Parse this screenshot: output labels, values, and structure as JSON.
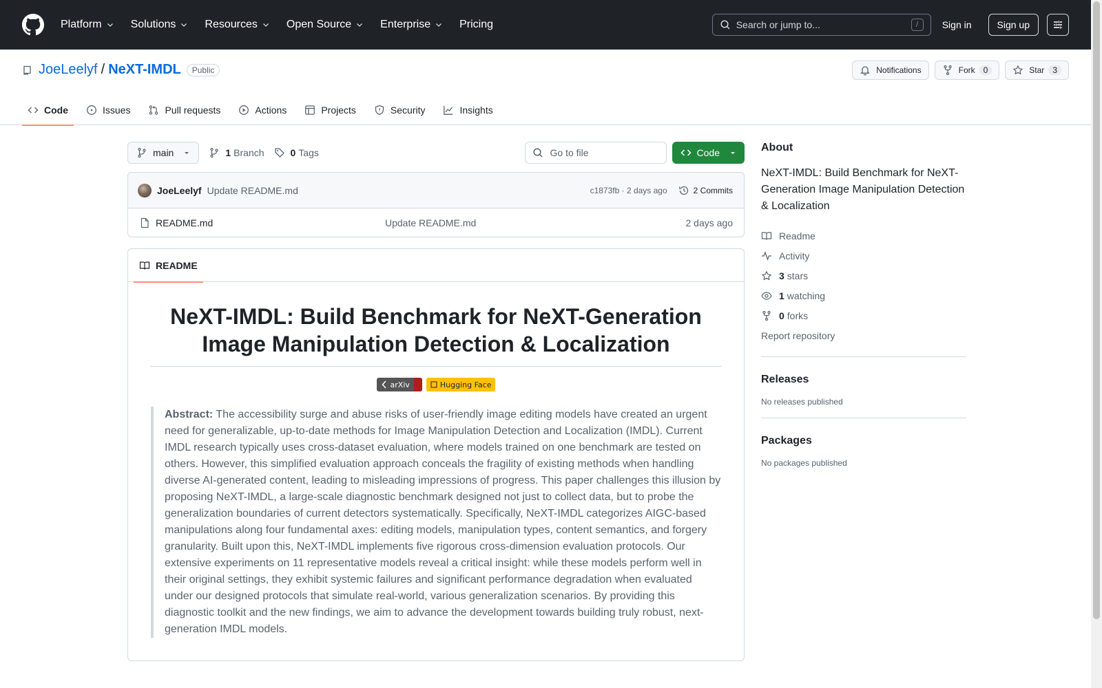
{
  "header": {
    "nav": [
      {
        "label": "Platform",
        "has_menu": true
      },
      {
        "label": "Solutions",
        "has_menu": true
      },
      {
        "label": "Resources",
        "has_menu": true
      },
      {
        "label": "Open Source",
        "has_menu": true
      },
      {
        "label": "Enterprise",
        "has_menu": true
      },
      {
        "label": "Pricing",
        "has_menu": false
      }
    ],
    "search_placeholder": "Search or jump to...",
    "search_shortcut": "/",
    "sign_in": "Sign in",
    "sign_up": "Sign up"
  },
  "repo": {
    "owner": "JoeLeelyf",
    "separator": "/",
    "name": "NeXT-IMDL",
    "visibility": "Public",
    "notifications_label": "Notifications",
    "fork_label": "Fork",
    "fork_count": "0",
    "star_label": "Star",
    "star_count": "3",
    "tabs": [
      {
        "label": "Code",
        "icon": "code-icon",
        "active": true
      },
      {
        "label": "Issues",
        "icon": "issue-icon",
        "active": false
      },
      {
        "label": "Pull requests",
        "icon": "pull-request-icon",
        "active": false
      },
      {
        "label": "Actions",
        "icon": "play-icon",
        "active": false
      },
      {
        "label": "Projects",
        "icon": "table-icon",
        "active": false
      },
      {
        "label": "Security",
        "icon": "shield-icon",
        "active": false
      },
      {
        "label": "Insights",
        "icon": "graph-icon",
        "active": false
      }
    ]
  },
  "toolbar": {
    "branch": "main",
    "branch_count": "1",
    "branch_label": "Branch",
    "tag_count": "0",
    "tag_label": "Tags",
    "goto_placeholder": "Go to file",
    "code_button": "Code"
  },
  "latest_commit": {
    "author": "JoeLeelyf",
    "message": "Update README.md",
    "meta": "c1873fb · 2 days ago",
    "commits_label": "2 Commits"
  },
  "files": [
    {
      "name": "README.md",
      "commit": "Update README.md",
      "age": "2 days ago"
    }
  ],
  "readme": {
    "tab_label": "README",
    "title": "NeXT-IMDL: Build Benchmark for NeXT-Generation Image Manipulation Detection & Localization",
    "badge_arxiv": "arXiv",
    "badge_hf": "Hugging Face",
    "abstract_label": "Abstract:",
    "abstract_text": " The accessibility surge and abuse risks of user-friendly image editing models have created an urgent need for generalizable, up-to-date methods for Image Manipulation Detection and Localization (IMDL). Current IMDL research typically uses cross-dataset evaluation, where models trained on one benchmark are tested on others. However, this simplified evaluation approach conceals the fragility of existing methods when handling diverse AI-generated content, leading to misleading impressions of progress. This paper challenges this illusion by proposing NeXT-IMDL, a large-scale diagnostic benchmark designed not just to collect data, but to probe the generalization boundaries of current detectors systematically. Specifically, NeXT-IMDL categorizes AIGC-based manipulations along four fundamental axes: editing models, manipulation types, content semantics, and forgery granularity. Built upon this, NeXT-IMDL implements five rigorous cross-dimension evaluation protocols. Our extensive experiments on 11 representative models reveal a critical insight: while these models perform well in their original settings, they exhibit systemic failures and significant performance degradation when evaluated under our designed protocols that simulate real-world, various generalization scenarios. By providing this diagnostic toolkit and the new findings, we aim to advance the development towards building truly robust, next-generation IMDL models."
  },
  "about": {
    "heading": "About",
    "description": "NeXT-IMDL: Build Benchmark for NeXT-Generation Image Manipulation Detection & Localization",
    "readme": "Readme",
    "activity": "Activity",
    "stars_count": "3",
    "stars_label": "stars",
    "watching_count": "1",
    "watching_label": "watching",
    "forks_count": "0",
    "forks_label": "forks",
    "report": "Report repository"
  },
  "releases": {
    "heading": "Releases",
    "empty": "No releases published"
  },
  "packages": {
    "heading": "Packages",
    "empty": "No packages published"
  },
  "colors": {
    "header_bg": "#1f2328",
    "link": "#0969da",
    "code_button": "#1f883d",
    "active_tab_underline": "#fd8c73",
    "arxiv_red": "#b31b1b",
    "hf_yellow": "#ffc107"
  }
}
